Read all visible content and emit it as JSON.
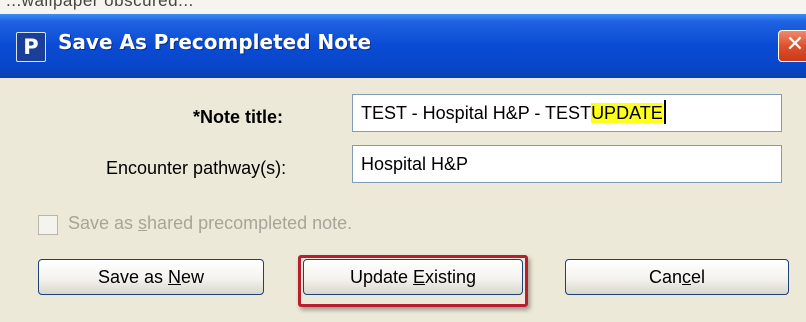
{
  "background": {
    "partial_text": "...wallpaper obscured..."
  },
  "dialog": {
    "app_icon_letter": "P",
    "title": "Save As Precompleted Note",
    "close_glyph": "✕"
  },
  "form": {
    "note_title": {
      "label": "*Note title:",
      "value_plain": "TEST - Hospital H&P - TEST",
      "value_highlighted": "UPDATE"
    },
    "encounter_pathways": {
      "label": "Encounter pathway(s):",
      "value": "Hospital H&P"
    },
    "shared_checkbox": {
      "label_before": "Save as ",
      "label_mnemonic": "s",
      "label_after": "hared precompleted note.",
      "checked": false,
      "enabled": false
    }
  },
  "buttons": {
    "save_new": {
      "before": "Save as ",
      "mnemonic": "N",
      "after": "ew"
    },
    "update_existing": {
      "before": "Update ",
      "mnemonic": "E",
      "after": "xisting"
    },
    "cancel": {
      "before": "Can",
      "mnemonic": "c",
      "after": "el"
    }
  },
  "colors": {
    "highlight": "#ffff1e",
    "callout_border": "#b81e2e",
    "titlebar": "#0a4bd4"
  }
}
